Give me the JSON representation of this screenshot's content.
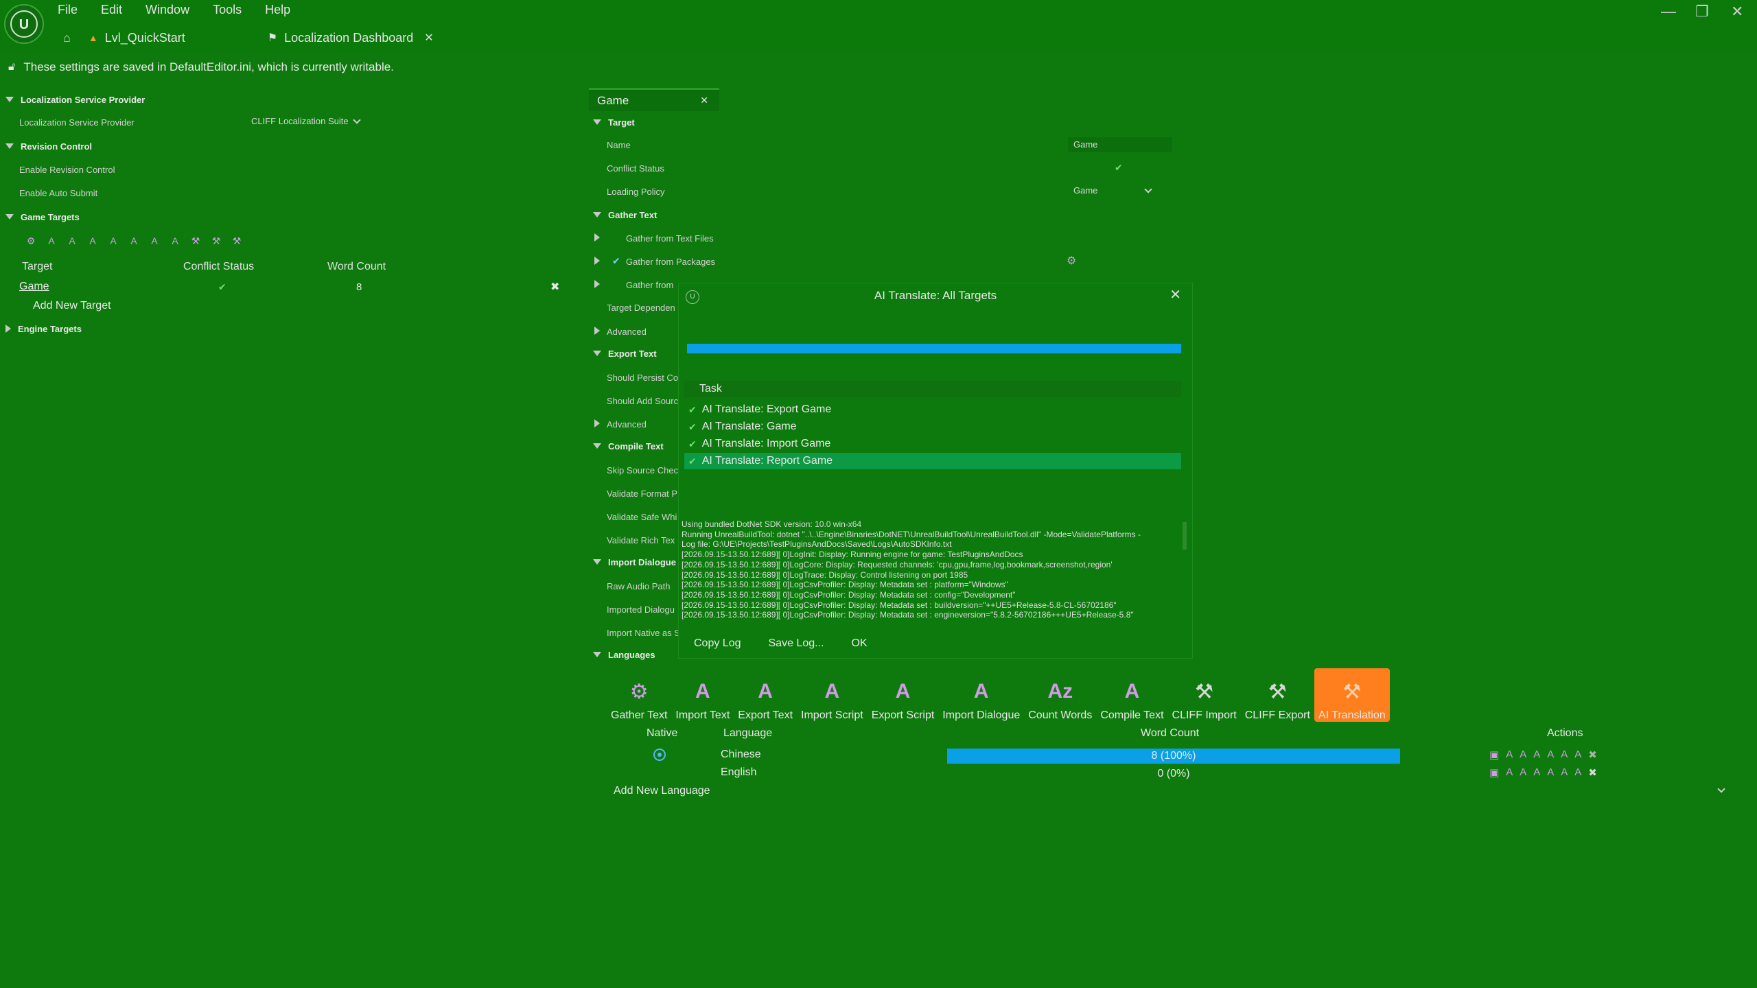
{
  "menu": [
    "File",
    "Edit",
    "Window",
    "Tools",
    "Help"
  ],
  "tabs": {
    "level": "Lvl_QuickStart",
    "dashboard": "Localization Dashboard"
  },
  "notice": "These settings are saved in DefaultEditor.ini, which is currently writable.",
  "left": {
    "lsp_section": "Localization Service Provider",
    "lsp_label": "Localization Service Provider",
    "lsp_value": "CLIFF Localization Suite",
    "rc_section": "Revision Control",
    "rc_enable": "Enable Revision Control",
    "rc_auto": "Enable Auto Submit",
    "gt_section": "Game Targets",
    "gt_col_target": "Target",
    "gt_col_conflict": "Conflict Status",
    "gt_col_words": "Word Count",
    "gt_row_name": "Game",
    "gt_row_words": "8",
    "gt_add": "Add New Target",
    "et_section": "Engine Targets"
  },
  "right": {
    "tab": "Game",
    "target": "Target",
    "name_label": "Name",
    "name_value": "Game",
    "conflict_label": "Conflict Status",
    "loading_label": "Loading Policy",
    "loading_value": "Game",
    "gather_text": "Gather Text",
    "gather_files": "Gather from Text Files",
    "gather_packages": "Gather from Packages",
    "gather_from": "Gather from",
    "target_dep": "Target Dependen",
    "advanced": "Advanced",
    "export_text": "Export Text",
    "should_persist": "Should Persist Co",
    "should_add": "Should Add Sourc",
    "advanced2": "Advanced",
    "compile_text": "Compile Text",
    "skip_source": "Skip Source Chec",
    "validate_format": "Validate Format P",
    "validate_safe": "Validate Safe Whi",
    "validate_rich": "Validate Rich Tex",
    "import_dialogue": "Import Dialogue",
    "raw_audio": "Raw Audio Path",
    "imported_dialogue": "Imported Dialogu",
    "import_native": "Import Native as S",
    "languages": "Languages"
  },
  "dialog": {
    "title": "AI Translate: All Targets",
    "task_header": "Task",
    "tasks": [
      "AI Translate: Export Game",
      "AI Translate: Game",
      "AI Translate: Import Game",
      "AI Translate: Report Game"
    ],
    "log": [
      "Using bundled DotNet SDK version: 10.0 win-x64",
      "Running UnrealBuildTool: dotnet \"..\\..\\Engine\\Binaries\\DotNET\\UnrealBuildTool\\UnrealBuildTool.dll\" -Mode=ValidatePlatforms -",
      "Log file: G:\\UE\\Projects\\TestPluginsAndDocs\\Saved\\Logs\\AutoSDKInfo.txt",
      "[2026.09.15-13.50.12:689][  0]LogInit: Display: Running engine for game: TestPluginsAndDocs",
      "[2026.09.15-13.50.12:689][  0]LogCore: Display: Requested channels: 'cpu,gpu,frame,log,bookmark,screenshot,region'",
      "[2026.09.15-13.50.12:689][  0]LogTrace: Display: Control listening on port 1985",
      "[2026.09.15-13.50.12:689][  0]LogCsvProfiler: Display: Metadata set : platform=\"Windows\"",
      "[2026.09.15-13.50.12:689][  0]LogCsvProfiler: Display: Metadata set : config=\"Development\"",
      "[2026.09.15-13.50.12:689][  0]LogCsvProfiler: Display: Metadata set : buildversion=\"++UE5+Release-5.8-CL-56702186\"",
      "[2026.09.15-13.50.12:689][  0]LogCsvProfiler: Display: Metadata set : engineversion=\"5.8.2-56702186+++UE5+Release-5.8\""
    ],
    "copy_log": "Copy Log",
    "save_log": "Save Log...",
    "ok": "OK",
    "progress": 1.0
  },
  "toolbar": [
    {
      "label": "Gather Text",
      "icon": "gather-text-icon"
    },
    {
      "label": "Import Text",
      "icon": "import-text-icon"
    },
    {
      "label": "Export Text",
      "icon": "export-text-icon"
    },
    {
      "label": "Import Script",
      "icon": "import-script-icon"
    },
    {
      "label": "Export Script",
      "icon": "export-script-icon"
    },
    {
      "label": "Import Dialogue",
      "icon": "import-dialogue-icon"
    },
    {
      "label": "Count Words",
      "icon": "count-words-icon"
    },
    {
      "label": "Compile Text",
      "icon": "compile-text-icon"
    },
    {
      "label": "CLIFF Import",
      "icon": "cliff-import-icon"
    },
    {
      "label": "CLIFF Export",
      "icon": "cliff-export-icon"
    },
    {
      "label": "AI Translation",
      "icon": "ai-translation-icon"
    }
  ],
  "languages": {
    "col_native": "Native",
    "col_language": "Language",
    "col_words": "Word Count",
    "col_actions": "Actions",
    "rows": [
      {
        "name": "Chinese",
        "count": "8 (100%)",
        "progress": 1.0
      },
      {
        "name": "English",
        "count": "0 (0%)",
        "progress": 0.0
      }
    ],
    "add": "Add New Language"
  },
  "colors": {
    "background": "#0e7a0e",
    "progress": "#0aa0e8",
    "active_tool": "#ff7f1e",
    "selected_row": "#0c9a45"
  }
}
